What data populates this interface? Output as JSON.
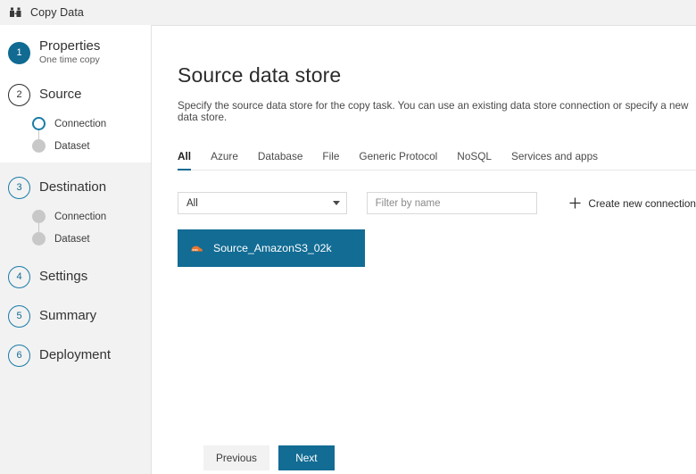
{
  "titlebar": {
    "icon": "copy-data-icon",
    "title": "Copy Data"
  },
  "colors": {
    "accent": "#106a92",
    "tile_selected": "#126c94",
    "sidebar_bg": "#f2f2f2",
    "panel_bg": "#ffffff",
    "s3_icon": "#e8762d"
  },
  "sidebar": {
    "steps": [
      {
        "number": "1",
        "label": "Properties",
        "sublabel": "One time copy",
        "state": "completed",
        "children": []
      },
      {
        "number": "2",
        "label": "Source",
        "sublabel": "",
        "state": "current",
        "children": [
          {
            "label": "Connection",
            "state": "current"
          },
          {
            "label": "Dataset",
            "state": "pending"
          }
        ]
      },
      {
        "number": "3",
        "label": "Destination",
        "sublabel": "",
        "state": "pending",
        "children": [
          {
            "label": "Connection",
            "state": "pending"
          },
          {
            "label": "Dataset",
            "state": "pending"
          }
        ]
      },
      {
        "number": "4",
        "label": "Settings",
        "sublabel": "",
        "state": "pending",
        "children": []
      },
      {
        "number": "5",
        "label": "Summary",
        "sublabel": "",
        "state": "pending",
        "children": []
      },
      {
        "number": "6",
        "label": "Deployment",
        "sublabel": "",
        "state": "pending",
        "children": []
      }
    ]
  },
  "main": {
    "title": "Source data store",
    "description": "Specify the source data store for the copy task. You can use an existing data store connection or specify a new data store.",
    "tabs": [
      {
        "label": "All",
        "active": true
      },
      {
        "label": "Azure",
        "active": false
      },
      {
        "label": "Database",
        "active": false
      },
      {
        "label": "File",
        "active": false
      },
      {
        "label": "Generic Protocol",
        "active": false
      },
      {
        "label": "NoSQL",
        "active": false
      },
      {
        "label": "Services and apps",
        "active": false
      }
    ],
    "filter_row": {
      "select_value": "All",
      "select_icon": "chevron-down-icon",
      "filter_placeholder": "Filter by name",
      "filter_value": "",
      "create_label": "Create new connection",
      "create_icon": "plus-icon"
    },
    "connections": [
      {
        "name": "Source_AmazonS3_02k",
        "icon": "amazon-s3-icon",
        "selected": true
      }
    ]
  },
  "footer": {
    "previous_label": "Previous",
    "next_label": "Next"
  }
}
